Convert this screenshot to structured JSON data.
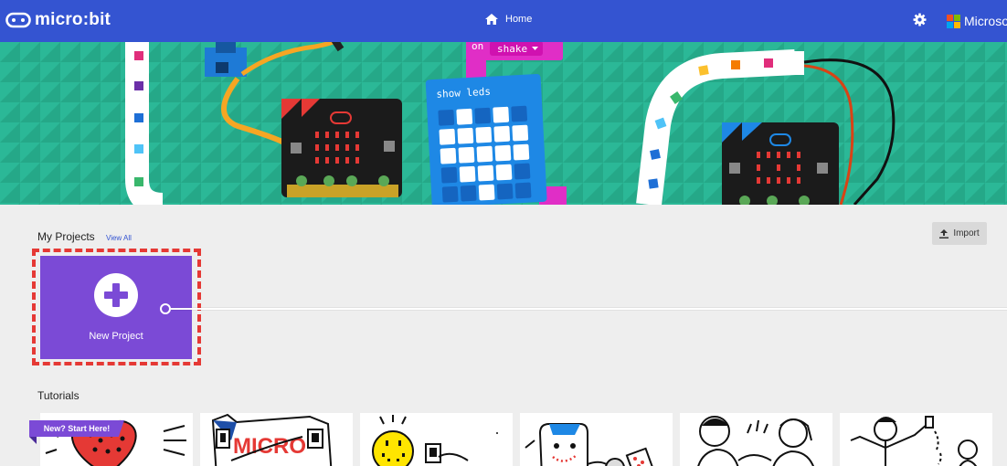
{
  "header": {
    "logo_text": "micro:bit",
    "home_label": "Home",
    "account_label": "Microsoft",
    "colors": {
      "bar": "#3454d1",
      "ms_red": "#f25022",
      "ms_green": "#7fba00",
      "ms_blue": "#00a4ef",
      "ms_yellow": "#ffb900"
    }
  },
  "hero": {
    "block_event": "on",
    "block_event_value": "shake",
    "block_show": "show leds",
    "colors": {
      "background": "#2bb897",
      "block_pink": "#e02ec6",
      "block_blue": "#1e88e5"
    }
  },
  "my_projects": {
    "title": "My Projects",
    "view_all": "View All",
    "import_label": "Import",
    "new_project_label": "New Project",
    "accent": "#7b4ad6"
  },
  "tutorials": {
    "title": "Tutorials",
    "badge": "New? Start Here!",
    "card_text_micro": "MICRO",
    "cards": [
      {
        "icon": "heart-illustration"
      },
      {
        "icon": "name-tag-illustration"
      },
      {
        "icon": "smiley-button-illustration"
      },
      {
        "icon": "dice-illustration"
      },
      {
        "icon": "rock-paper-scissors-illustration"
      },
      {
        "icon": "step-counter-illustration"
      }
    ]
  }
}
